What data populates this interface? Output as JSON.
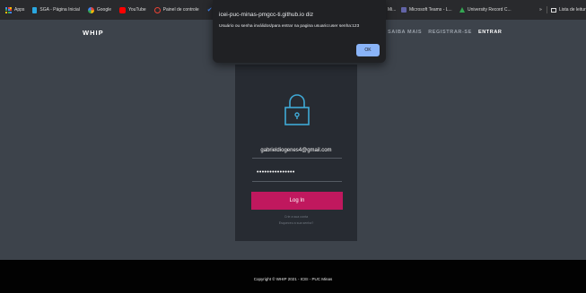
{
  "bookmarks": {
    "items": [
      {
        "label": "Apps",
        "icon": "apps-grid-icon",
        "color": "#4285f4"
      },
      {
        "label": "SGA - Página Inicial",
        "icon": "sga-icon",
        "color": "#2aa7e0"
      },
      {
        "label": "Google",
        "icon": "google-icon",
        "color": "#ffffff"
      },
      {
        "label": "YouTube",
        "icon": "youtube-icon",
        "color": "#ff0000"
      },
      {
        "label": "Painel de controle",
        "icon": "dashboard-icon",
        "color": "#ea4335"
      }
    ],
    "partial": "Mi...",
    "teams": "Microsoft Teams - L...",
    "university": "University Record C...",
    "more": "»",
    "reading_list": "Lista de leitur"
  },
  "nav": {
    "logo": "WHIP",
    "links": [
      "SAIBA MAIS",
      "REGISTRAR-SE",
      "ENTRAR"
    ]
  },
  "login": {
    "email": "gabrieldiogenes4@gmail.com",
    "password": "•••••••••••••••",
    "button": "Log In",
    "create_account": "Crie a sua conta",
    "forgot_password": "Esqueceu a sua senha?"
  },
  "footer": {
    "copyright": "Copyright © WHIP 2021 - ICEI - PUC Minas"
  },
  "dialog": {
    "title": "icei-puc-minas-pmgcc-ti.github.io diz",
    "message": "Usuário ou senha inválidos/para entrar na pagina usuario:user senha:123",
    "ok": "OK"
  },
  "colors": {
    "page_bg": "#3d434b",
    "card_bg": "#272b32",
    "accent": "#c0185e",
    "dialog_button": "#8ab4f8",
    "lock_icon": "#3fa9d6"
  }
}
